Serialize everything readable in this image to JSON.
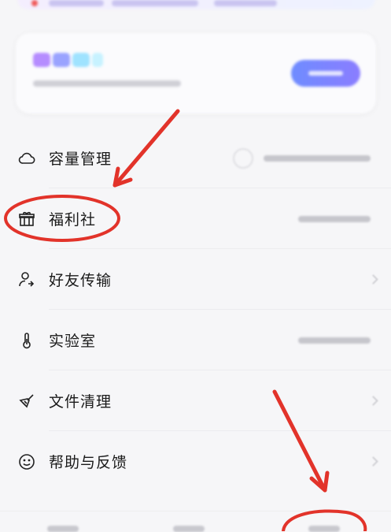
{
  "menu": {
    "items": [
      {
        "label": "容量管理",
        "icon": "cloud-icon"
      },
      {
        "label": "福利社",
        "icon": "gift-icon"
      },
      {
        "label": "好友传输",
        "icon": "friend-transfer-icon"
      },
      {
        "label": "实验室",
        "icon": "thermometer-icon"
      },
      {
        "label": "文件清理",
        "icon": "broom-icon"
      },
      {
        "label": "帮助与反馈",
        "icon": "smile-icon"
      }
    ]
  },
  "colors": {
    "annotation": "#e2332a",
    "accent": "#7b86ff"
  }
}
